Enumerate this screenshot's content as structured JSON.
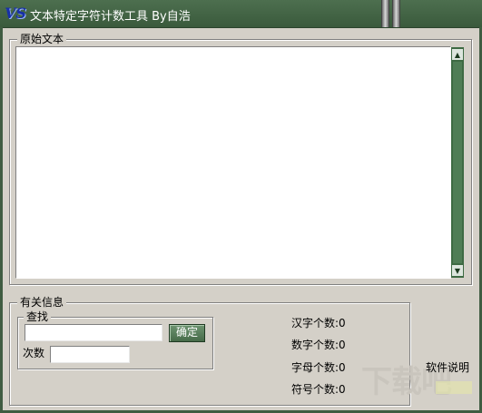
{
  "window": {
    "title": "文本特定字符计数工具 By自浩",
    "logo_text": "VS",
    "theme_color": "#3f5c41"
  },
  "source_group": {
    "label": "原始文本",
    "text_value": ""
  },
  "info_group": {
    "label": "有关信息",
    "search_group": {
      "label": "查找",
      "search_value": "",
      "confirm_label": "确定",
      "count_label": "次数",
      "count_value": ""
    },
    "stats": [
      {
        "label": "汉字个数:",
        "value": "0"
      },
      {
        "label": "数字个数:",
        "value": "0"
      },
      {
        "label": "字母个数:",
        "value": "0"
      },
      {
        "label": "符号个数:",
        "value": "0"
      }
    ],
    "help_label": "软件说明"
  }
}
